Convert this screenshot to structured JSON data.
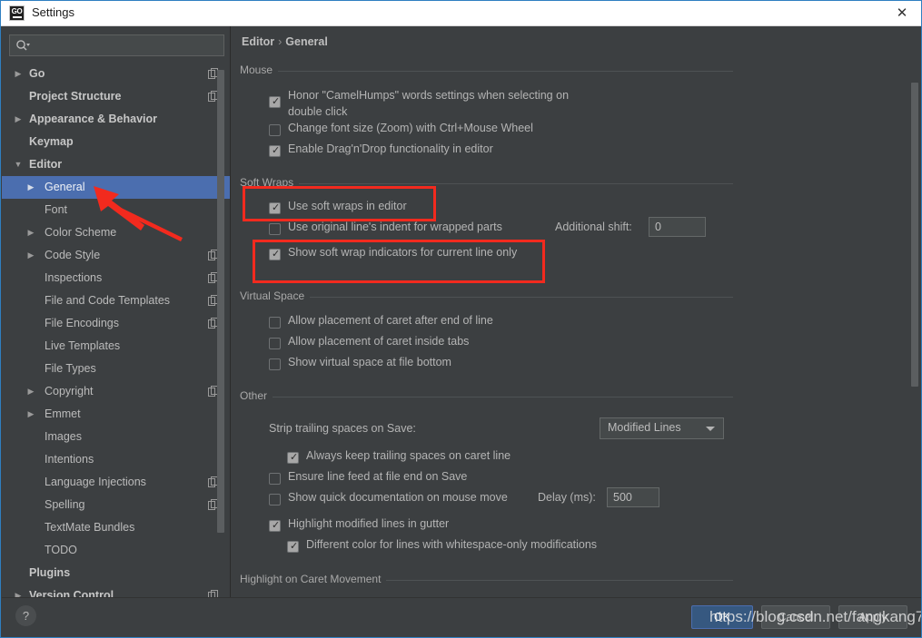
{
  "window": {
    "title": "Settings",
    "app_icon": "goland-go-icon",
    "close_icon": "close-icon"
  },
  "sidebar": {
    "search": {
      "placeholder": "",
      "value": "",
      "icon": "search-icon"
    },
    "items": [
      {
        "label": "Go",
        "depth": 0,
        "twisty": "▶",
        "bold": true,
        "selected": false,
        "copy": true
      },
      {
        "label": "Project Structure",
        "depth": 0,
        "twisty": "",
        "bold": true,
        "selected": false,
        "copy": true
      },
      {
        "label": "Appearance & Behavior",
        "depth": 0,
        "twisty": "▶",
        "bold": true,
        "selected": false,
        "copy": false
      },
      {
        "label": "Keymap",
        "depth": 0,
        "twisty": "",
        "bold": true,
        "selected": false,
        "copy": false
      },
      {
        "label": "Editor",
        "depth": 0,
        "twisty": "▼",
        "bold": true,
        "selected": false,
        "copy": false
      },
      {
        "label": "General",
        "depth": 1,
        "twisty": "▶",
        "bold": false,
        "selected": true,
        "copy": false
      },
      {
        "label": "Font",
        "depth": 1,
        "twisty": "",
        "bold": false,
        "selected": false,
        "copy": false
      },
      {
        "label": "Color Scheme",
        "depth": 1,
        "twisty": "▶",
        "bold": false,
        "selected": false,
        "copy": false
      },
      {
        "label": "Code Style",
        "depth": 1,
        "twisty": "▶",
        "bold": false,
        "selected": false,
        "copy": true
      },
      {
        "label": "Inspections",
        "depth": 1,
        "twisty": "",
        "bold": false,
        "selected": false,
        "copy": true
      },
      {
        "label": "File and Code Templates",
        "depth": 1,
        "twisty": "",
        "bold": false,
        "selected": false,
        "copy": true
      },
      {
        "label": "File Encodings",
        "depth": 1,
        "twisty": "",
        "bold": false,
        "selected": false,
        "copy": true
      },
      {
        "label": "Live Templates",
        "depth": 1,
        "twisty": "",
        "bold": false,
        "selected": false,
        "copy": false
      },
      {
        "label": "File Types",
        "depth": 1,
        "twisty": "",
        "bold": false,
        "selected": false,
        "copy": false
      },
      {
        "label": "Copyright",
        "depth": 1,
        "twisty": "▶",
        "bold": false,
        "selected": false,
        "copy": true
      },
      {
        "label": "Emmet",
        "depth": 1,
        "twisty": "▶",
        "bold": false,
        "selected": false,
        "copy": false
      },
      {
        "label": "Images",
        "depth": 1,
        "twisty": "",
        "bold": false,
        "selected": false,
        "copy": false
      },
      {
        "label": "Intentions",
        "depth": 1,
        "twisty": "",
        "bold": false,
        "selected": false,
        "copy": false
      },
      {
        "label": "Language Injections",
        "depth": 1,
        "twisty": "",
        "bold": false,
        "selected": false,
        "copy": true
      },
      {
        "label": "Spelling",
        "depth": 1,
        "twisty": "",
        "bold": false,
        "selected": false,
        "copy": true
      },
      {
        "label": "TextMate Bundles",
        "depth": 1,
        "twisty": "",
        "bold": false,
        "selected": false,
        "copy": false
      },
      {
        "label": "TODO",
        "depth": 1,
        "twisty": "",
        "bold": false,
        "selected": false,
        "copy": false
      },
      {
        "label": "Plugins",
        "depth": 0,
        "twisty": "",
        "bold": true,
        "selected": false,
        "copy": false
      },
      {
        "label": "Version Control",
        "depth": 0,
        "twisty": "▶",
        "bold": true,
        "selected": false,
        "copy": true
      }
    ]
  },
  "main": {
    "breadcrumb": {
      "parent": "Editor",
      "separator": "›",
      "current": "General"
    },
    "groups": {
      "mouse": {
        "title": "Mouse",
        "options": [
          {
            "label": "Honor \"CamelHumps\" words settings when selecting on double click",
            "checked": true
          },
          {
            "label": "Change font size (Zoom) with Ctrl+Mouse Wheel",
            "checked": false
          },
          {
            "label": "Enable Drag'n'Drop functionality in editor",
            "checked": true
          }
        ]
      },
      "soft_wraps": {
        "title": "Soft Wraps",
        "options": [
          {
            "label": "Use soft wraps in editor",
            "checked": true
          },
          {
            "label": "Use original line's indent for wrapped parts",
            "checked": false
          },
          {
            "label": "Show soft wrap indicators for current line only",
            "checked": true
          }
        ],
        "additional_shift_label": "Additional shift:",
        "additional_shift_value": "0"
      },
      "virtual_space": {
        "title": "Virtual Space",
        "options": [
          {
            "label": "Allow placement of caret after end of line",
            "checked": false
          },
          {
            "label": "Allow placement of caret inside tabs",
            "checked": false
          },
          {
            "label": "Show virtual space at file bottom",
            "checked": false
          }
        ]
      },
      "other": {
        "title": "Other",
        "strip_label": "Strip trailing spaces on Save:",
        "strip_value": "Modified Lines",
        "options": [
          {
            "label": "Always keep trailing spaces on caret line",
            "checked": true
          },
          {
            "label": "Ensure line feed at file end on Save",
            "checked": false
          },
          {
            "label": "Show quick documentation on mouse move",
            "checked": false
          },
          {
            "label": "Highlight modified lines in gutter",
            "checked": true
          },
          {
            "label": "Different color for lines with whitespace-only modifications",
            "checked": true
          }
        ],
        "delay_label": "Delay (ms):",
        "delay_value": "500"
      },
      "highlight_caret": {
        "title": "Highlight on Caret Movement"
      }
    }
  },
  "footer": {
    "help_icon": "question-mark-icon",
    "buttons": [
      {
        "label": "OK",
        "primary": true
      },
      {
        "label": "Cancel",
        "primary": false
      },
      {
        "label": "Apply",
        "primary": false
      }
    ]
  },
  "annotations": {
    "watermark": "https://blog.csdn.net/fangkang7",
    "highlight_color": "#f22a1e",
    "arrow_color": "#f22a1e",
    "accent_color": "#4b6eaf"
  }
}
